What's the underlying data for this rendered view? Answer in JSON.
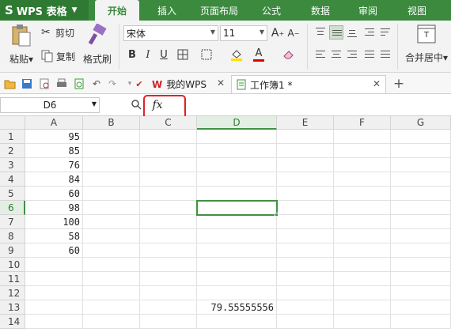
{
  "app": {
    "name": "WPS 表格"
  },
  "tabs": [
    "开始",
    "插入",
    "页面布局",
    "公式",
    "数据",
    "审阅",
    "视图"
  ],
  "active_tab": "开始",
  "ribbon": {
    "paste_label": "粘贴",
    "cut_label": "剪切",
    "copy_label": "复制",
    "format_painter_label": "格式刷",
    "font_name": "宋体",
    "font_size": "11",
    "merge_center_label": "合并居中"
  },
  "doc_tabs": [
    {
      "label": "我的WPS"
    },
    {
      "label": "工作簿1 *"
    }
  ],
  "formula_bar": {
    "name_box": "D6",
    "fx_label": "fx",
    "formula": ""
  },
  "grid": {
    "columns": [
      "A",
      "B",
      "C",
      "D",
      "E",
      "F",
      "G"
    ],
    "rows": [
      "1",
      "2",
      "3",
      "4",
      "5",
      "6",
      "7",
      "8",
      "9",
      "10",
      "11",
      "12",
      "13",
      "14"
    ],
    "selected_column": "D",
    "selected_row": "6",
    "cells": {
      "A1": "95",
      "A2": "85",
      "A3": "76",
      "A4": "84",
      "A5": "60",
      "A6": "98",
      "A7": "100",
      "A8": "58",
      "A9": "60",
      "D13": "79.55555556"
    }
  },
  "colors": {
    "brand_green": "#3b8a3e",
    "highlight_red": "#e0232b"
  }
}
